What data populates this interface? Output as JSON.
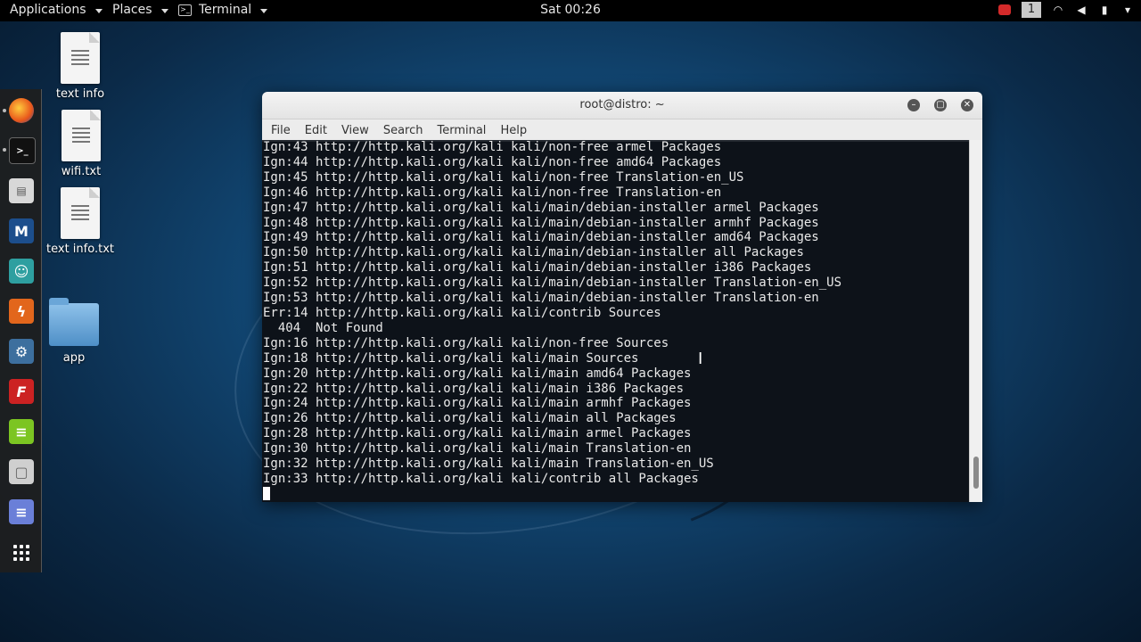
{
  "topbar": {
    "applications": "Applications",
    "places": "Places",
    "terminal": "Terminal",
    "clock": "Sat 00:26",
    "workspace": "1"
  },
  "dock": {
    "items": [
      "firefox-icon",
      "terminal-icon",
      "files-icon",
      "metasploit-icon",
      "armitage-icon",
      "burpsuite-icon",
      "maltego-icon",
      "faraday-icon",
      "leafpad-icon",
      "settings-icon",
      "text-editor-icon",
      "show-apps-icon"
    ]
  },
  "desktop": {
    "icons": [
      {
        "label": "text info"
      },
      {
        "label": "wifi.txt"
      },
      {
        "label": "text info.txt"
      },
      {
        "label": "app"
      }
    ]
  },
  "window": {
    "title": "root@distro: ~",
    "menu": [
      "File",
      "Edit",
      "View",
      "Search",
      "Terminal",
      "Help"
    ],
    "lines": [
      "Ign:43 http://http.kali.org/kali kali/non-free armel Packages",
      "Ign:44 http://http.kali.org/kali kali/non-free amd64 Packages",
      "Ign:45 http://http.kali.org/kali kali/non-free Translation-en_US",
      "Ign:46 http://http.kali.org/kali kali/non-free Translation-en",
      "Ign:47 http://http.kali.org/kali kali/main/debian-installer armel Packages",
      "Ign:48 http://http.kali.org/kali kali/main/debian-installer armhf Packages",
      "Ign:49 http://http.kali.org/kali kali/main/debian-installer amd64 Packages",
      "Ign:50 http://http.kali.org/kali kali/main/debian-installer all Packages",
      "Ign:51 http://http.kali.org/kali kali/main/debian-installer i386 Packages",
      "Ign:52 http://http.kali.org/kali kali/main/debian-installer Translation-en_US",
      "Ign:53 http://http.kali.org/kali kali/main/debian-installer Translation-en",
      "Err:14 http://http.kali.org/kali kali/contrib Sources",
      "  404  Not Found",
      "Ign:16 http://http.kali.org/kali kali/non-free Sources",
      "Ign:18 http://http.kali.org/kali kali/main Sources",
      "Ign:20 http://http.kali.org/kali kali/main amd64 Packages",
      "Ign:22 http://http.kali.org/kali kali/main i386 Packages",
      "Ign:24 http://http.kali.org/kali kali/main armhf Packages",
      "Ign:26 http://http.kali.org/kali kali/main all Packages",
      "Ign:28 http://http.kali.org/kali kali/main armel Packages",
      "Ign:30 http://http.kali.org/kali kali/main Translation-en",
      "Ign:32 http://http.kali.org/kali kali/main Translation-en_US",
      "Ign:33 http://http.kali.org/kali kali/contrib all Packages"
    ]
  }
}
